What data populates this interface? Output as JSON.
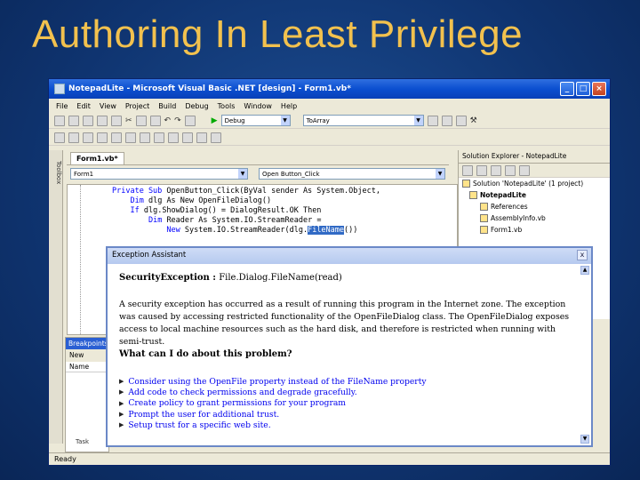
{
  "slide": {
    "title": "Authoring In Least Privilege"
  },
  "window": {
    "title": "NotepadLite - Microsoft Visual Basic .NET [design] - Form1.vb*",
    "menu": [
      "File",
      "Edit",
      "View",
      "Project",
      "Build",
      "Debug",
      "Tools",
      "Window",
      "Help"
    ],
    "config_combo": "Debug",
    "find_combo": "ToArray",
    "toolbox_label": "Toolbox",
    "doc_tab": "Form1.vb*",
    "class_combo": "Form1",
    "method_combo": "Open Button_Click",
    "status": "Ready"
  },
  "code": {
    "lines": [
      {
        "pre": "",
        "kw": "Private Sub ",
        "rest": "OpenButton_Click(ByVal sender As System.Object,"
      },
      {
        "pre": "    ",
        "kw": "Dim ",
        "rest": "dlg As New OpenFileDialog()"
      },
      {
        "pre": "    ",
        "kw": "If ",
        "rest": "dlg.ShowDialog() = DialogResult.OK Then"
      },
      {
        "pre": "        ",
        "kw": "Dim ",
        "rest": "Reader As System.IO.StreamReader ="
      },
      {
        "pre": "            ",
        "kw": "New ",
        "rest": "System.IO.StreamReader(dlg."
      }
    ],
    "selected": "FileName",
    "after_selected": "())"
  },
  "solution_explorer": {
    "title": "Solution Explorer - NotepadLite",
    "items": [
      "Solution 'NotepadLite' (1 project)",
      "NotepadLite",
      "References",
      "AssemblyInfo.vb",
      "Form1.vb"
    ]
  },
  "breakpoints": {
    "title": "Breakpoints",
    "new_label": "New",
    "col_name": "Name",
    "task_tab": "Task"
  },
  "exception": {
    "title": "Exception Assistant",
    "close": "x",
    "heading_type": "SecurityException :",
    "heading_detail": "File.Dialog.FileName(read)",
    "description": "A security exception has occurred as a result of running this program in the Internet zone. The exception was caused by accessing restricted functionality of the OpenFileDialog class. The OpenFileDialog exposes access to local machine resources such as the hard disk, and therefore is restricted when running with semi-trust.",
    "question": "What can I do about this problem?",
    "actions": [
      "Consider using the OpenFile property instead of the FileName property",
      "Add code to check permissions and degrade gracefully.",
      "Create policy to grant permissions for your program",
      "Prompt the user for additional trust.",
      "Setup trust for a specific web site."
    ]
  }
}
